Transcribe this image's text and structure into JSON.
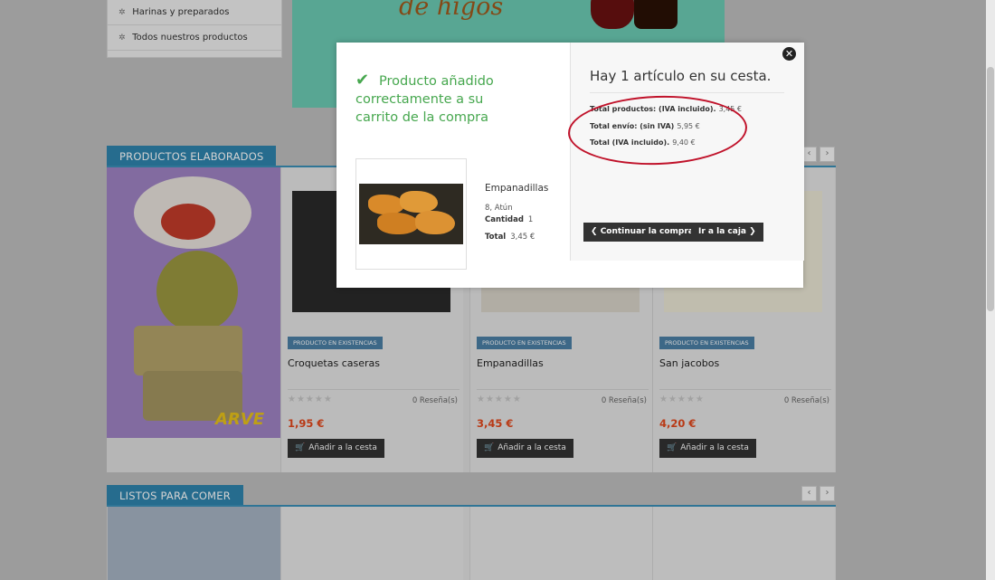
{
  "menu": {
    "items": [
      {
        "label": "Harinas y preparados"
      },
      {
        "label": "Todos nuestros productos"
      }
    ]
  },
  "banner": {
    "text": "de higos"
  },
  "sections": [
    {
      "title": "PRODUCTOS ELABORADOS"
    },
    {
      "title": "LISTOS PARA COMER"
    }
  ],
  "nav": {
    "prev": "‹",
    "next": "›"
  },
  "products": [
    {
      "stock": "PRODUCTO EN EXISTENCIAS",
      "name": "Croquetas caseras",
      "reviews": "0 Reseña(s)",
      "price": "1,95 €",
      "add": "Añadir a la cesta"
    },
    {
      "stock": "PRODUCTO EN EXISTENCIAS",
      "name": "Empanadillas",
      "reviews": "0 Reseña(s)",
      "price": "3,45 €",
      "add": "Añadir a la cesta"
    },
    {
      "stock": "PRODUCTO EN EXISTENCIAS",
      "name": "San jacobos",
      "reviews": "0 Reseña(s)",
      "price": "4,20 €",
      "add": "Añadir a la cesta"
    }
  ],
  "feature_image": {
    "logo": "ARVE"
  },
  "modal": {
    "success": "Producto añadido correctamente a su carrito de la compra",
    "product": {
      "name": "Empanadillas",
      "attributes": "8, Atún",
      "quantity_label": "Cantidad",
      "quantity": "1",
      "total_label": "Total",
      "total": "3,45 €"
    },
    "cart": {
      "title": "Hay 1 artículo en su cesta.",
      "products_label": "Total productos: (IVA incluido).",
      "products_value": "3,45 €",
      "shipping_label": "Total envío: (sin IVA)",
      "shipping_value": "5,95 €",
      "total_label": "Total (IVA incluido).",
      "total_value": "9,40 €"
    },
    "continue_label": "Continuar la compra",
    "checkout_label": "Ir a la caja",
    "close": "✕"
  },
  "colors": {
    "accent": "#2f84ae",
    "success": "#46a74e",
    "price": "#e2471b",
    "highlight": "#c0122a"
  }
}
